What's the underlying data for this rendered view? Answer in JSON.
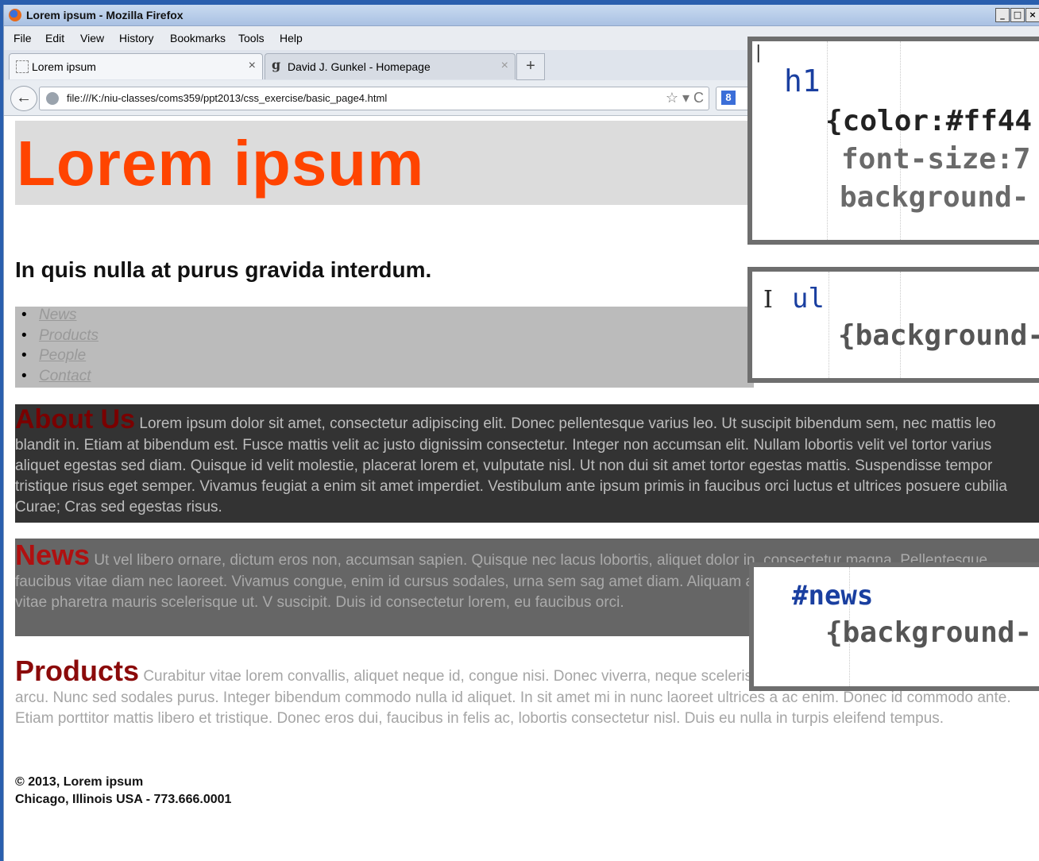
{
  "window": {
    "title": "Lorem ipsum - Mozilla Firefox",
    "controls": [
      "_",
      "□",
      "×"
    ]
  },
  "menu": [
    "File",
    "Edit",
    "View",
    "History",
    "Bookmarks",
    "Tools",
    "Help"
  ],
  "tabs": [
    {
      "label": "Lorem ipsum",
      "close": "×"
    },
    {
      "label": "David J. Gunkel - Homepage",
      "close": "×"
    }
  ],
  "new_tab_label": "+",
  "nav": {
    "url": "file:///K:/niu-classes/coms359/ppt2013/css_exercise/basic_page4.html",
    "icons": "☆ ▾ C",
    "search_engine": "8"
  },
  "page": {
    "h1": "Lorem ipsum",
    "h2": "In quis nulla at purus gravida interdum.",
    "nav_items": [
      "News",
      "Products",
      "People",
      "Contact"
    ],
    "about": {
      "heading": "About Us",
      "text": "Lorem ipsum dolor sit amet, consectetur adipiscing elit. Donec pellentesque varius leo. Ut suscipit bibendum sem, nec mattis leo blandit in. Etiam at bibendum est. Fusce mattis velit ac justo dignissim consectetur. Integer non accumsan elit. Nullam lobortis velit vel tortor varius aliquet egestas sed diam. Quisque id velit molestie, placerat lorem et, vulputate nisl. Ut non dui sit amet tortor egestas mattis. Suspendisse tempor tristique risus eget semper. Vivamus feugiat a enim sit amet imperdiet. Vestibulum ante ipsum primis in faucibus orci luctus et ultrices posuere cubilia Curae; Cras sed egestas risus."
    },
    "news": {
      "heading": "News",
      "text": "Ut vel libero ornare, dictum eros non, accumsan sapien. Quisque nec lacus lobortis, aliquet dolor in, consectetur magna. Pellentesque faucibus vitae diam nec laoreet. Vivamus congue, enim id cursus sodales, urna sem sag amet diam. Aliquam a vehicula ligula. Nulla pulvinar aliquet est, vitae pharetra mauris scelerisque ut. V suscipit. Duis id consectetur lorem, eu faucibus orci."
    },
    "products": {
      "heading": "Products",
      "text": "Curabitur vitae lorem convallis, aliquet neque id, congue nisi. Donec viverra, neque scelerisque est, non lobortis risus metus vitae arcu. Nunc sed sodales purus. Integer bibendum commodo nulla id aliquet. In sit amet mi in nunc laoreet ultrices a ac enim. Donec id commodo ante. Etiam porttitor mattis libero et tristique. Donec eros dui, faucibus in felis ac, lobortis consectetur nisl. Duis eu nulla in turpis eleifend tempus."
    },
    "footer": {
      "line1": "© 2013, Lorem ipsum",
      "line2": "Chicago, Illinois USA - 773.666.0001"
    }
  },
  "callouts": {
    "h1": {
      "selector": "h1",
      "l1": "{color:#ff44",
      "l2": "font-size:7",
      "l3": "background-"
    },
    "ul": {
      "selector": "ul",
      "l1": "{background-"
    },
    "news": {
      "selector": "#news",
      "l1": "{background-"
    }
  },
  "colors": {
    "h1_text": "#ff4400",
    "h1_bg": "#dcdcdc",
    "ul_bg": "#bbbbbb",
    "about_bg": "#333333",
    "news_bg": "#666666",
    "heading_red": "#8b0a0a"
  }
}
